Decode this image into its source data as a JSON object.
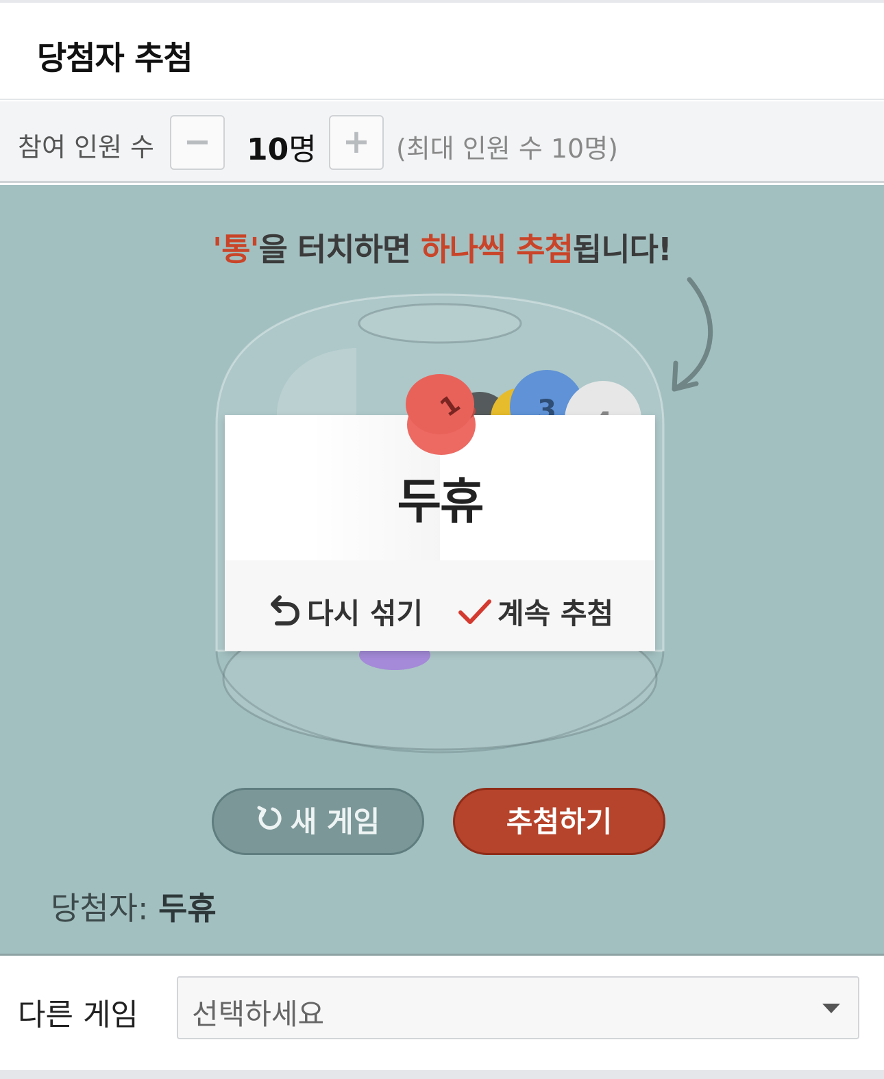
{
  "header": {
    "title": "당첨자 추첨"
  },
  "participants": {
    "label": "참여 인원 수",
    "minus_symbol": "−",
    "plus_symbol": "+",
    "count": "10",
    "unit": "명",
    "max_note": "(최대 인원 수 10명)"
  },
  "stage": {
    "instruction": {
      "quote_word": "'통'",
      "part1": "을 터치하면 ",
      "highlight": "하나씩 추첨",
      "part2": "됩니다!"
    },
    "balls": [
      "1",
      "3",
      "4"
    ],
    "result": {
      "name": "두휴",
      "shuffle_label": "다시 섞기",
      "continue_label": "계속 추첨"
    },
    "new_game_label": "새 게임",
    "draw_label": "추첨하기",
    "winner_prefix": "당첨자:",
    "winner_name": "두휴"
  },
  "other_game": {
    "label": "다른 게임",
    "select_value": "선택하세요"
  },
  "colors": {
    "accent_red": "#c94428",
    "draw_button": "#b6432b",
    "stage_bg": "#a3c0c1",
    "new_game_button": "#7b9798"
  },
  "icons": [
    "undo-icon",
    "check-icon",
    "refresh-icon",
    "caret-down-icon",
    "arrow-curve-icon"
  ]
}
